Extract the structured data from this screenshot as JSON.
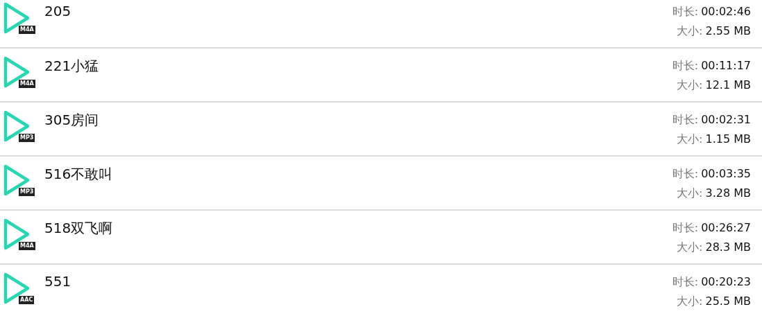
{
  "files": [
    {
      "title": "205",
      "format": "M4A",
      "duration_label": "时长:",
      "duration": "00:02:46",
      "size_label": "大小:",
      "size": "2.55 MB"
    },
    {
      "title": "221小猛",
      "format": "M4A",
      "duration_label": "时长:",
      "duration": "00:11:17",
      "size_label": "大小:",
      "size": "12.1 MB"
    },
    {
      "title": "305房间",
      "format": "MP3",
      "duration_label": "时长:",
      "duration": "00:02:31",
      "size_label": "大小:",
      "size": "1.15 MB"
    },
    {
      "title": "516不敢叫",
      "format": "MP3",
      "duration_label": "时长:",
      "duration": "00:03:35",
      "size_label": "大小:",
      "size": "3.28 MB"
    },
    {
      "title": "518双飞啊",
      "format": "M4A",
      "duration_label": "时长:",
      "duration": "00:26:27",
      "size_label": "大小:",
      "size": "28.3 MB"
    },
    {
      "title": "551",
      "format": "AAC",
      "duration_label": "时长:",
      "duration": "00:20:23",
      "size_label": "大小:",
      "size": "25.5 MB"
    }
  ]
}
